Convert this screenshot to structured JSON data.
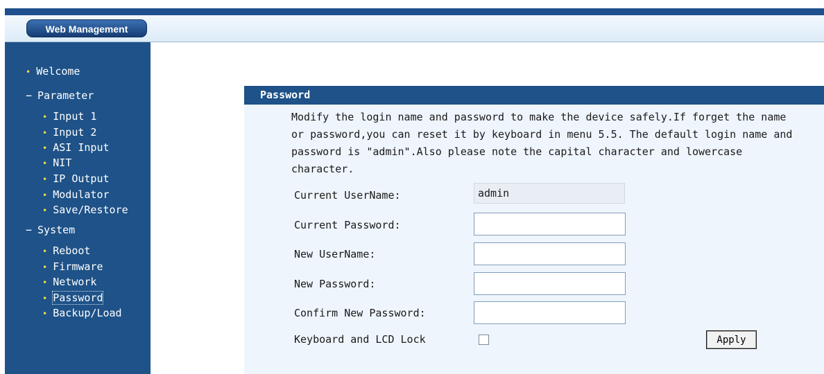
{
  "header": {
    "title": "Web Management"
  },
  "sidebar": {
    "bullet_glyph": "•",
    "items": [
      {
        "label": "Welcome",
        "kind": "link"
      },
      {
        "label": "Parameter",
        "kind": "group"
      },
      {
        "label": "Input 1",
        "kind": "link"
      },
      {
        "label": "Input 2",
        "kind": "link"
      },
      {
        "label": "ASI Input",
        "kind": "link"
      },
      {
        "label": "NIT",
        "kind": "link"
      },
      {
        "label": "IP Output",
        "kind": "link"
      },
      {
        "label": "Modulator",
        "kind": "link"
      },
      {
        "label": "Save/Restore",
        "kind": "link"
      },
      {
        "label": "System",
        "kind": "group"
      },
      {
        "label": "Reboot",
        "kind": "link"
      },
      {
        "label": "Firmware",
        "kind": "link"
      },
      {
        "label": "Network",
        "kind": "link"
      },
      {
        "label": "Password",
        "kind": "link",
        "active": true
      },
      {
        "label": "Backup/Load",
        "kind": "link"
      }
    ]
  },
  "panel": {
    "title": "Password",
    "description": "Modify the login name and password to make the device safely.If forget the name or password,you can reset it by keyboard in menu 5.5. The default login name and password is \"admin\".Also please note the capital character and lowercase character.",
    "fields": {
      "current_username": {
        "label": "Current UserName:",
        "value": "admin"
      },
      "current_password": {
        "label": "Current Password:",
        "value": ""
      },
      "new_username": {
        "label": "New UserName:",
        "value": ""
      },
      "new_password": {
        "label": "New Password:",
        "value": ""
      },
      "confirm_password": {
        "label": "Confirm New Password:",
        "value": ""
      }
    },
    "lock": {
      "label": "Keyboard and LCD Lock",
      "checked": false
    },
    "apply_label": "Apply"
  },
  "colors": {
    "nav_bg": "#1e5288",
    "bullet": "#f5d84a",
    "panel_bg": "#eef5fc",
    "header_stripe": "#1f4f8c"
  }
}
